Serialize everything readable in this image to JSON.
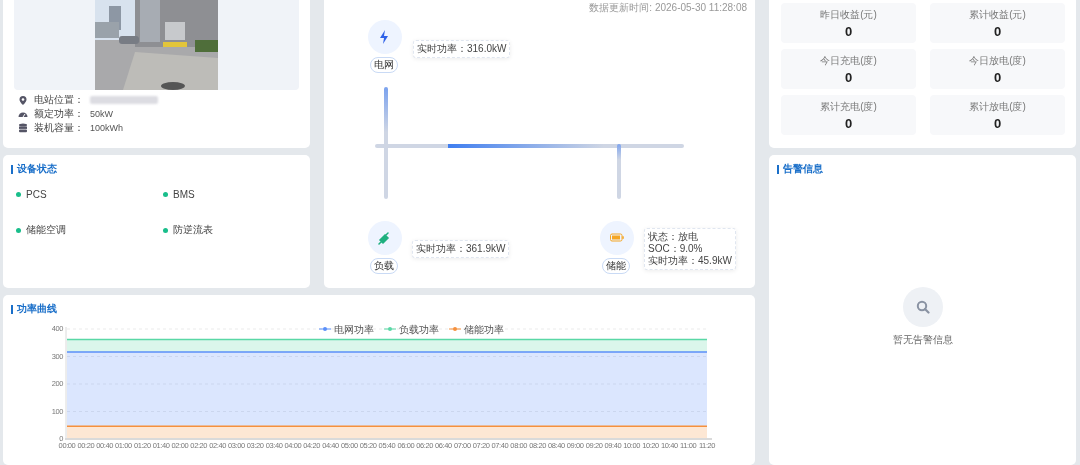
{
  "station": {
    "info": [
      {
        "kind": "location",
        "label": "电站位置：",
        "redacted": true
      },
      {
        "kind": "power",
        "label": "额定功率：",
        "value": "50kW",
        "redacted": false
      },
      {
        "kind": "capacity",
        "label": "装机容量：",
        "value": "100kWh",
        "redacted": false
      }
    ]
  },
  "device_status": {
    "title": "设备状态",
    "items": [
      {
        "name": "PCS",
        "online": true
      },
      {
        "name": "BMS",
        "online": true
      },
      {
        "name": "储能空调",
        "online": true
      },
      {
        "name": "防逆流表",
        "online": true
      }
    ]
  },
  "flow": {
    "updated": "数据更新时间: 2026-05-30 11:28:08",
    "nodes": [
      {
        "kind": "grid",
        "label": "电网",
        "info": [
          "实时功率：316.0kW"
        ]
      },
      {
        "kind": "load",
        "label": "负载",
        "info": [
          "实时功率：361.9kW"
        ]
      },
      {
        "kind": "storage",
        "label": "储能",
        "info": [
          "状态：放电",
          "SOC：9.0%",
          "实时功率：45.9kW"
        ]
      }
    ]
  },
  "stats": [
    {
      "label": "昨日收益(元)",
      "value": "0"
    },
    {
      "label": "累计收益(元)",
      "value": "0"
    },
    {
      "label": "今日充电(度)",
      "value": "0"
    },
    {
      "label": "今日放电(度)",
      "value": "0"
    },
    {
      "label": "累计充电(度)",
      "value": "0"
    },
    {
      "label": "累计放电(度)",
      "value": "0"
    }
  ],
  "alerts": {
    "title": "告警信息",
    "empty_text": "暂无告警信息"
  },
  "power_curve": {
    "title": "功率曲线",
    "chart_data": {
      "type": "area",
      "grid": true,
      "legend": true,
      "ylim": [
        0,
        400
      ],
      "yticks": [
        0,
        100,
        200,
        300,
        400
      ],
      "categories": [
        "00:00",
        "00:20",
        "00:40",
        "01:00",
        "01:20",
        "01:40",
        "02:00",
        "02:20",
        "02:40",
        "03:00",
        "03:20",
        "03:40",
        "04:00",
        "04:20",
        "04:40",
        "05:00",
        "05:20",
        "05:40",
        "06:00",
        "06:20",
        "06:40",
        "07:00",
        "07:20",
        "07:40",
        "08:00",
        "08:20",
        "08:40",
        "09:00",
        "09:20",
        "09:40",
        "10:00",
        "10:20",
        "10:40",
        "11:00",
        "11:20"
      ],
      "series": [
        {
          "name": "电网功率",
          "color": "#5b8ff9",
          "values": [
            316,
            316,
            316,
            316,
            316,
            316,
            316,
            316,
            316,
            316,
            316,
            316,
            316,
            316,
            316,
            316,
            316,
            316,
            316,
            316,
            316,
            316,
            316,
            316,
            316,
            316,
            316,
            316,
            316,
            316,
            316,
            316,
            316,
            316,
            316
          ]
        },
        {
          "name": "负载功率",
          "color": "#5ad8a6",
          "values": [
            362,
            362,
            362,
            362,
            362,
            362,
            362,
            362,
            362,
            362,
            362,
            362,
            362,
            362,
            362,
            362,
            362,
            362,
            362,
            362,
            362,
            362,
            362,
            362,
            362,
            362,
            362,
            362,
            362,
            362,
            362,
            362,
            362,
            362,
            362
          ]
        },
        {
          "name": "储能功率",
          "color": "#f6903d",
          "values": [
            46,
            46,
            46,
            46,
            46,
            46,
            46,
            46,
            46,
            46,
            46,
            46,
            46,
            46,
            46,
            46,
            46,
            46,
            46,
            46,
            46,
            46,
            46,
            46,
            46,
            46,
            46,
            46,
            46,
            46,
            46,
            46,
            46,
            46,
            46
          ]
        }
      ]
    }
  }
}
